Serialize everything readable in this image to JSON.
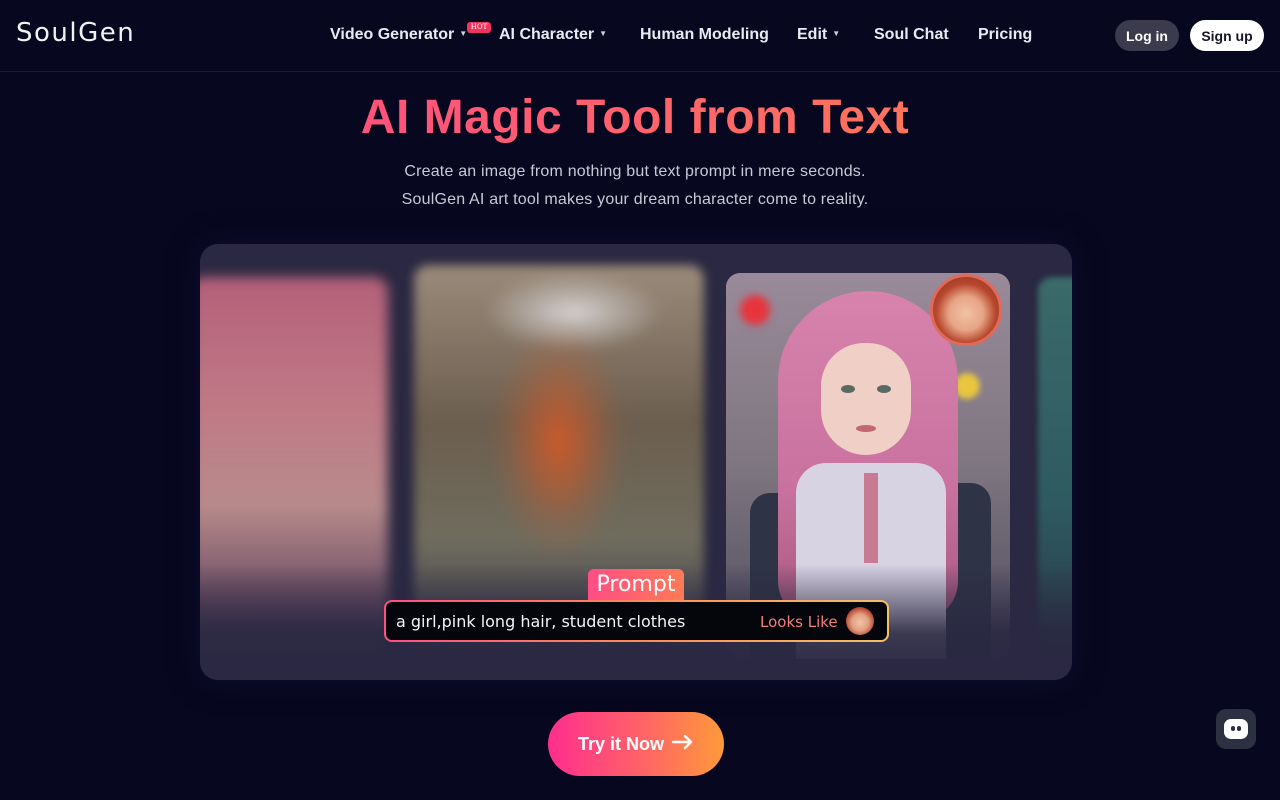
{
  "header": {
    "logo": "SoulGen",
    "nav": [
      {
        "label": "Video Generator",
        "caret": true
      },
      {
        "label": "AI Character",
        "caret": true
      },
      {
        "label": "Human Modeling",
        "caret": false
      },
      {
        "label": "Edit",
        "caret": true
      },
      {
        "label": "Soul Chat",
        "caret": false
      },
      {
        "label": "Pricing",
        "caret": false
      }
    ],
    "hot_badge": "HOT",
    "login_label": "Log in",
    "signup_label": "Sign up"
  },
  "hero": {
    "title": "AI Magic Tool from Text",
    "subtitle_line1": "Create an image from nothing but text prompt in mere seconds.",
    "subtitle_line2": "SoulGen AI art tool makes your dream character come to reality."
  },
  "showcase": {
    "prompt_tag": "Prompt",
    "prompt_text": "a girl,pink long hair, student clothes",
    "looks_like_label": "Looks Like"
  },
  "cta": {
    "label": "Try it Now",
    "icon": "arrow-right-icon"
  },
  "chat_widget": {
    "icon": "chat-icon"
  },
  "colors": {
    "background": "#07071f",
    "accent_start": "#ff2e8e",
    "accent_end": "#ff9a3a"
  }
}
